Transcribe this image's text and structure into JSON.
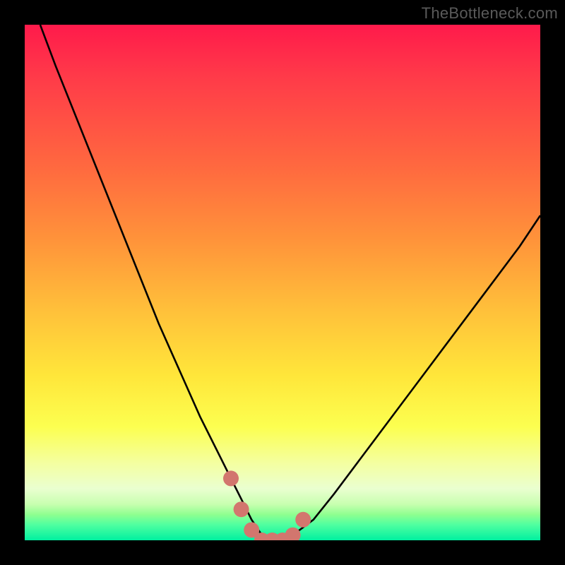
{
  "watermark": "TheBottleneck.com",
  "colors": {
    "frame": "#000000",
    "curve_stroke": "#000000",
    "marker_fill": "#d2766e",
    "gradient_top": "#ff1a4b",
    "gradient_bottom": "#00f0a0"
  },
  "chart_data": {
    "type": "line",
    "title": "",
    "xlabel": "",
    "ylabel": "",
    "xlim": [
      0,
      100
    ],
    "ylim": [
      0,
      100
    ],
    "series": [
      {
        "name": "bottleneck-curve",
        "x": [
          3,
          6,
          10,
          14,
          18,
          22,
          26,
          30,
          34,
          38,
          40,
          42,
          44,
          46,
          48,
          50,
          52,
          56,
          60,
          66,
          72,
          78,
          84,
          90,
          96,
          100
        ],
        "y": [
          100,
          92,
          82,
          72,
          62,
          52,
          42,
          33,
          24,
          16,
          12,
          8,
          4,
          1,
          0,
          0,
          1,
          4,
          9,
          17,
          25,
          33,
          41,
          49,
          57,
          63
        ]
      }
    ],
    "markers": {
      "name": "optimal-range-dots",
      "x": [
        40,
        42,
        44,
        46,
        48,
        50,
        52,
        54
      ],
      "y": [
        12,
        6,
        2,
        0,
        0,
        0,
        1,
        4
      ]
    }
  }
}
